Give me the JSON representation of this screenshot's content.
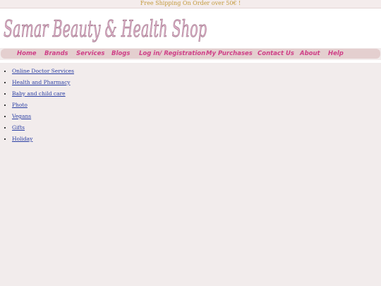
{
  "shipping_banner": "Free Shipping On Order over 50€ !",
  "logo": {
    "text": "Samar Beauty & Health Shop",
    "color": "#d9a9c2"
  },
  "nav": {
    "items": [
      {
        "label": "Home"
      },
      {
        "label": "Brands"
      },
      {
        "label": "Services"
      },
      {
        "label": "Blogs"
      },
      {
        "label": "Log in/ Registration"
      },
      {
        "label": "My Purchases"
      },
      {
        "label": "Contact Us"
      },
      {
        "label": "About"
      },
      {
        "label": "Help"
      }
    ],
    "color": "#cf3f87",
    "background": "#e4cfcf"
  },
  "categories": [
    {
      "label": "Online Doctor Services"
    },
    {
      "label": "Health and Pharmacy"
    },
    {
      "label": "Baby and child care"
    },
    {
      "label": "Photo"
    },
    {
      "label": "Vegans"
    },
    {
      "label": "Gifts"
    },
    {
      "label": "Holiday"
    }
  ]
}
